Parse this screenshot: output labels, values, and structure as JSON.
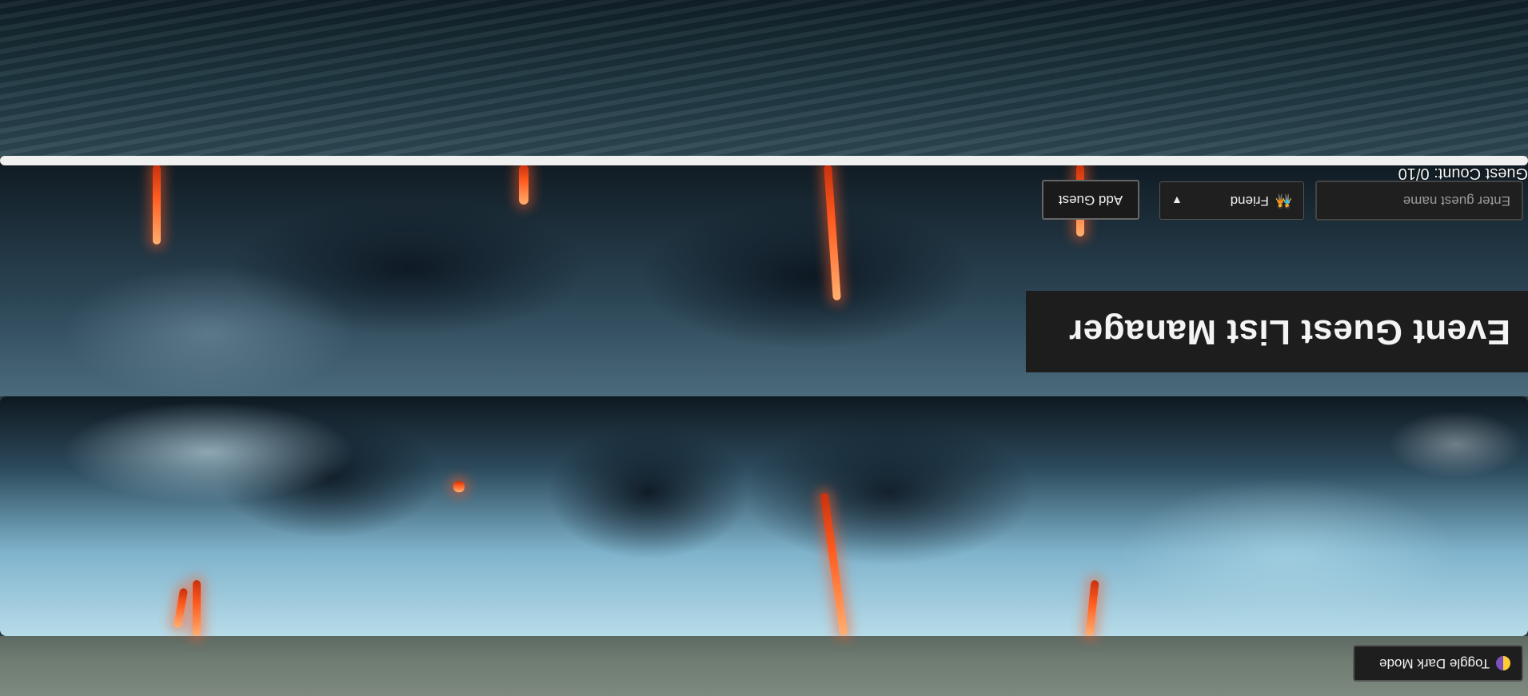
{
  "theme_toggle": {
    "label": "Toggle Dark Mode",
    "icon": "half-moon-icon"
  },
  "header": {
    "title": "Event Guest List Manager"
  },
  "form": {
    "name_placeholder": "Enter guest name",
    "category_selected": "Friend",
    "category_icon": "people-icon",
    "add_label": "Add Guest"
  },
  "guest_count": {
    "label": "Guest Count: 0/10"
  },
  "colors": {
    "panel": "#1d1d1d",
    "text": "#f4f4f4",
    "divider": "#f0f0f0"
  }
}
